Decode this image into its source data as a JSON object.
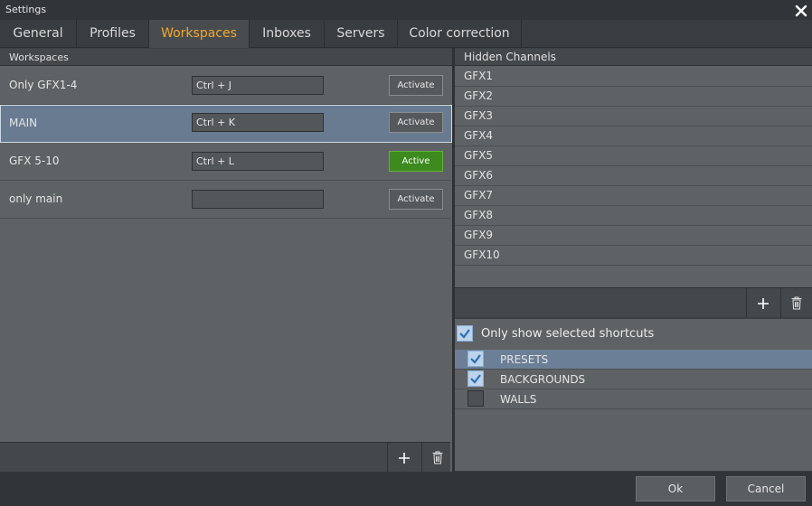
{
  "window": {
    "title": "Settings"
  },
  "tabs": [
    {
      "label": "General"
    },
    {
      "label": "Profiles"
    },
    {
      "label": "Workspaces"
    },
    {
      "label": "Inboxes"
    },
    {
      "label": "Servers"
    },
    {
      "label": "Color correction"
    }
  ],
  "workspaces": {
    "header": "Workspaces",
    "rows": [
      {
        "name": "Only GFX1-4",
        "shortcut": "Ctrl + J",
        "button": "Activate"
      },
      {
        "name": "MAIN",
        "shortcut": "Ctrl + K",
        "button": "Activate"
      },
      {
        "name": "GFX 5-10",
        "shortcut": "Ctrl + L",
        "button": "Active"
      },
      {
        "name": "only main",
        "shortcut": "",
        "button": "Activate"
      }
    ]
  },
  "hidden_channels": {
    "header": "Hidden Channels",
    "items": [
      "GFX1",
      "GFX2",
      "GFX3",
      "GFX4",
      "GFX5",
      "GFX6",
      "GFX7",
      "GFX8",
      "GFX9",
      "GFX10"
    ]
  },
  "shortcuts": {
    "only_show_label": "Only show selected shortcuts",
    "only_show_checked": true,
    "items": [
      {
        "label": "PRESETS",
        "checked": true
      },
      {
        "label": "BACKGROUNDS",
        "checked": true
      },
      {
        "label": "WALLS",
        "checked": false
      }
    ]
  },
  "dialog": {
    "ok": "Ok",
    "cancel": "Cancel"
  },
  "colors": {
    "accent": "#f0a82a",
    "active_green": "#3d8a1e",
    "selection": "#697b91"
  }
}
